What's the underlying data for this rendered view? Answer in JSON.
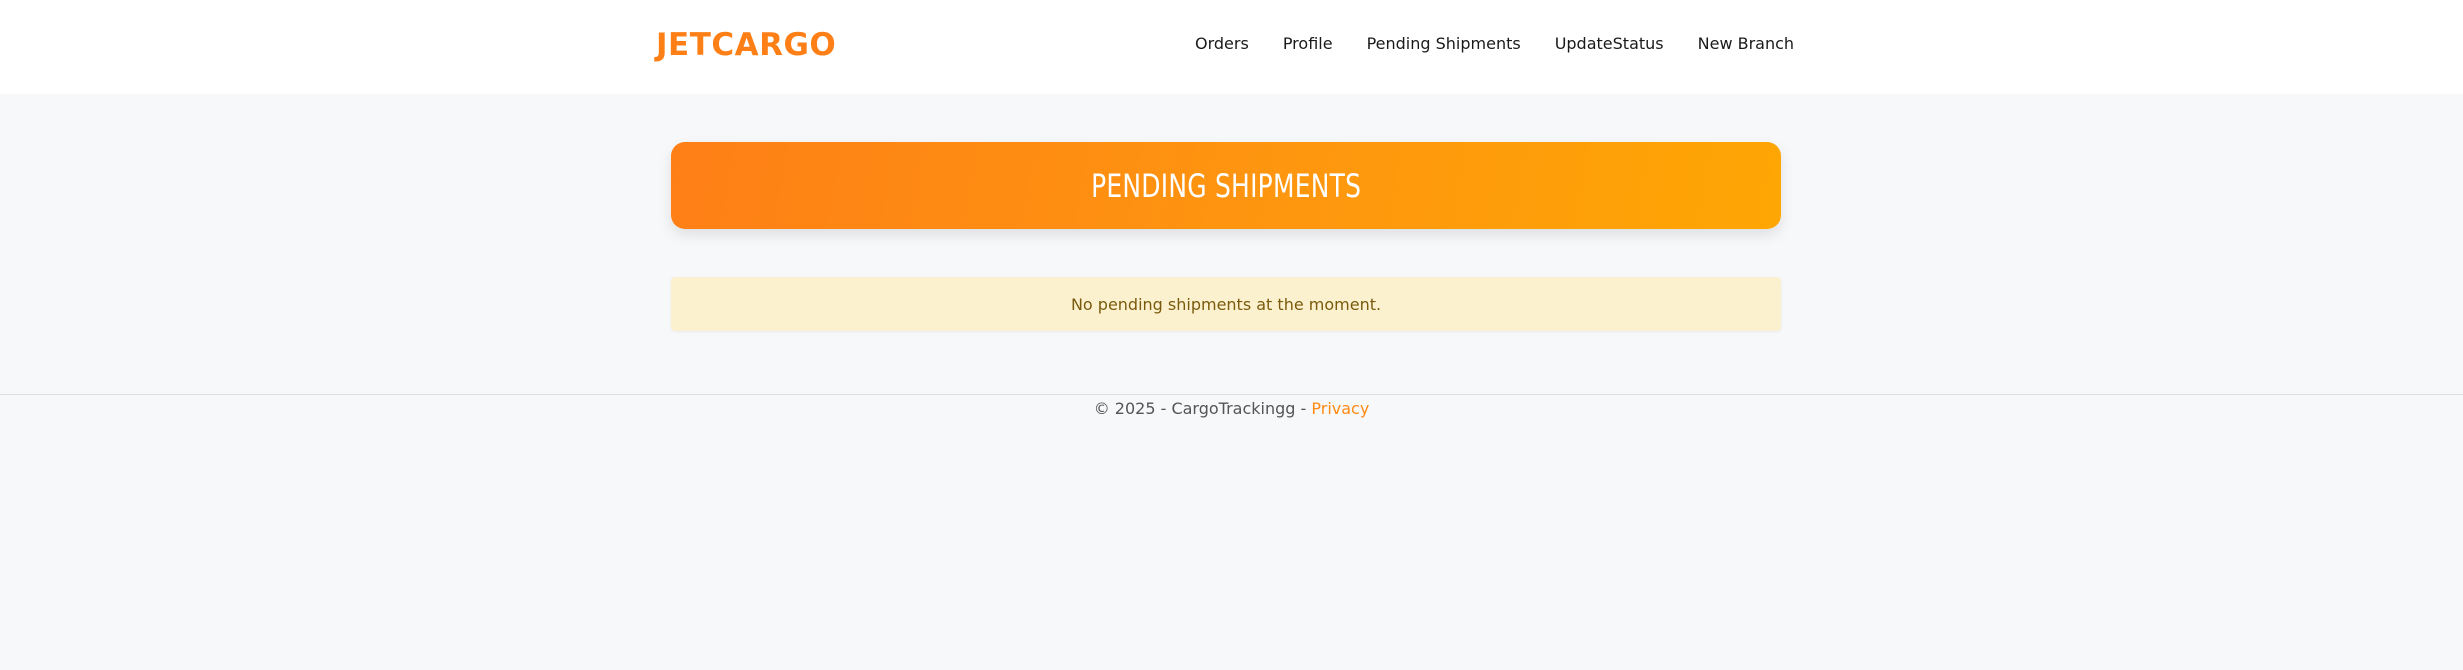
{
  "header": {
    "brand": "JETCARGO",
    "nav": [
      {
        "label": "Orders"
      },
      {
        "label": "Profile"
      },
      {
        "label": "Pending Shipments"
      },
      {
        "label": "UpdateStatus"
      },
      {
        "label": "New Branch"
      }
    ]
  },
  "main": {
    "title": "PENDING SHIPMENTS",
    "empty_message": "No pending shipments at the moment."
  },
  "footer": {
    "text": "© 2025 - CargoTrackingg - ",
    "privacy_label": "Privacy"
  },
  "colors": {
    "brand": "#fe7f16",
    "hero_start": "#fe7f16",
    "hero_end": "#fea604",
    "notice_bg": "#fcf1cf",
    "notice_text": "#7a5a0c",
    "link": "#fe8a12",
    "page_bg": "#f7f8fa"
  }
}
